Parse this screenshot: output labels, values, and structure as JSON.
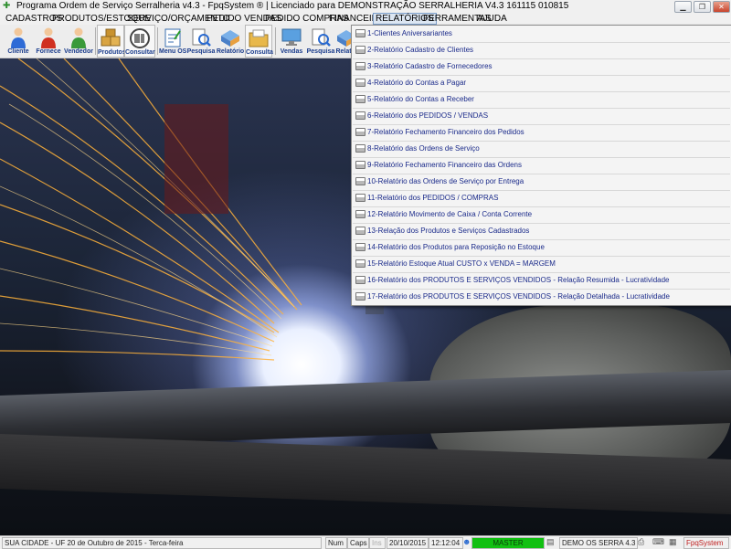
{
  "window": {
    "title": "Programa Ordem de Serviço Serralheria v4.3 - FpqSystem ® | Licenciado para  DEMONSTRAÇÃO SERRALHERIA V4.3 161115 010815",
    "controls": [
      "minimize-icon",
      "restore-icon",
      "close-icon"
    ]
  },
  "menubar": {
    "items": [
      "CADASTROS",
      "PRODUTOS/ESTOQUE",
      "SERVIÇO/ORÇAMENTO",
      "PEDIDO VENDAS",
      "PEDIDO COMPRAS",
      "FINANCEIRO",
      "RELATÓRIOS",
      "FERRAMENTAS",
      "AJUDA"
    ],
    "active": "RELATÓRIOS"
  },
  "toolbar": {
    "buttons": [
      {
        "label": "Cliente",
        "icon": "person-icon"
      },
      {
        "label": "Fornece",
        "icon": "person-red-icon"
      },
      {
        "label": "Vendedor",
        "icon": "person-green-icon"
      },
      {
        "label": "Produtos",
        "icon": "boxes-icon"
      },
      {
        "label": "Consultar",
        "icon": "barcode-icon"
      },
      {
        "label": "Menu OS",
        "icon": "clipboard-icon"
      },
      {
        "label": "Pesquisa",
        "icon": "magnifier-doc-icon"
      },
      {
        "label": "Relatório",
        "icon": "report-icon"
      },
      {
        "label": "Consulta",
        "icon": "folder-icon"
      },
      {
        "label": "Vendas",
        "icon": "monitor-icon"
      },
      {
        "label": "Pesquisa",
        "icon": "magnifier-doc-icon"
      },
      {
        "label": "Relat",
        "icon": "report-icon"
      }
    ]
  },
  "reports_menu": {
    "items": [
      "1-Clientes Aniversariantes",
      "2-Relatório Cadastro de Clientes",
      "3-Relatório Cadastro de Fornecedores",
      "4-Relatório do Contas a Pagar",
      "5-Relatório do Contas a Receber",
      "6-Relatório dos PEDIDOS / VENDAS",
      "7-Relatório Fechamento Financeiro dos Pedidos",
      "8-Relatório das Ordens de Serviço",
      "9-Relatório Fechamento Financeiro das Ordens",
      "10-Relatório das Ordens de Serviço por Entrega",
      "11-Relatório dos PEDIDOS / COMPRAS",
      "12-Relatório Movimento de Caixa / Conta Corrente",
      "13-Relação dos Produtos e Serviços Cadastrados",
      "14-Relatório dos Produtos para Reposição no Estoque",
      "15-Relatório Estoque Atual CUSTO x VENDA = MARGEM",
      "16-Relatório dos PRODUTOS E SERVIÇOS VENDIDOS - Relação Resumida - Lucratividade",
      "17-Relatório dos PRODUTOS E SERVIÇOS VENDIDOS - Relação Detalhada - Lucratividade"
    ]
  },
  "statusbar": {
    "location": "SUA CIDADE - UF 20 de Outubro de 2015 - Terca-feira",
    "num": "Num",
    "caps": "Caps",
    "ins": "Ins",
    "date": "20/10/2015",
    "time": "12:12:04",
    "master": "MASTER",
    "product": "DEMO OS SERRA 4.3",
    "brand": "FpqSystem"
  }
}
